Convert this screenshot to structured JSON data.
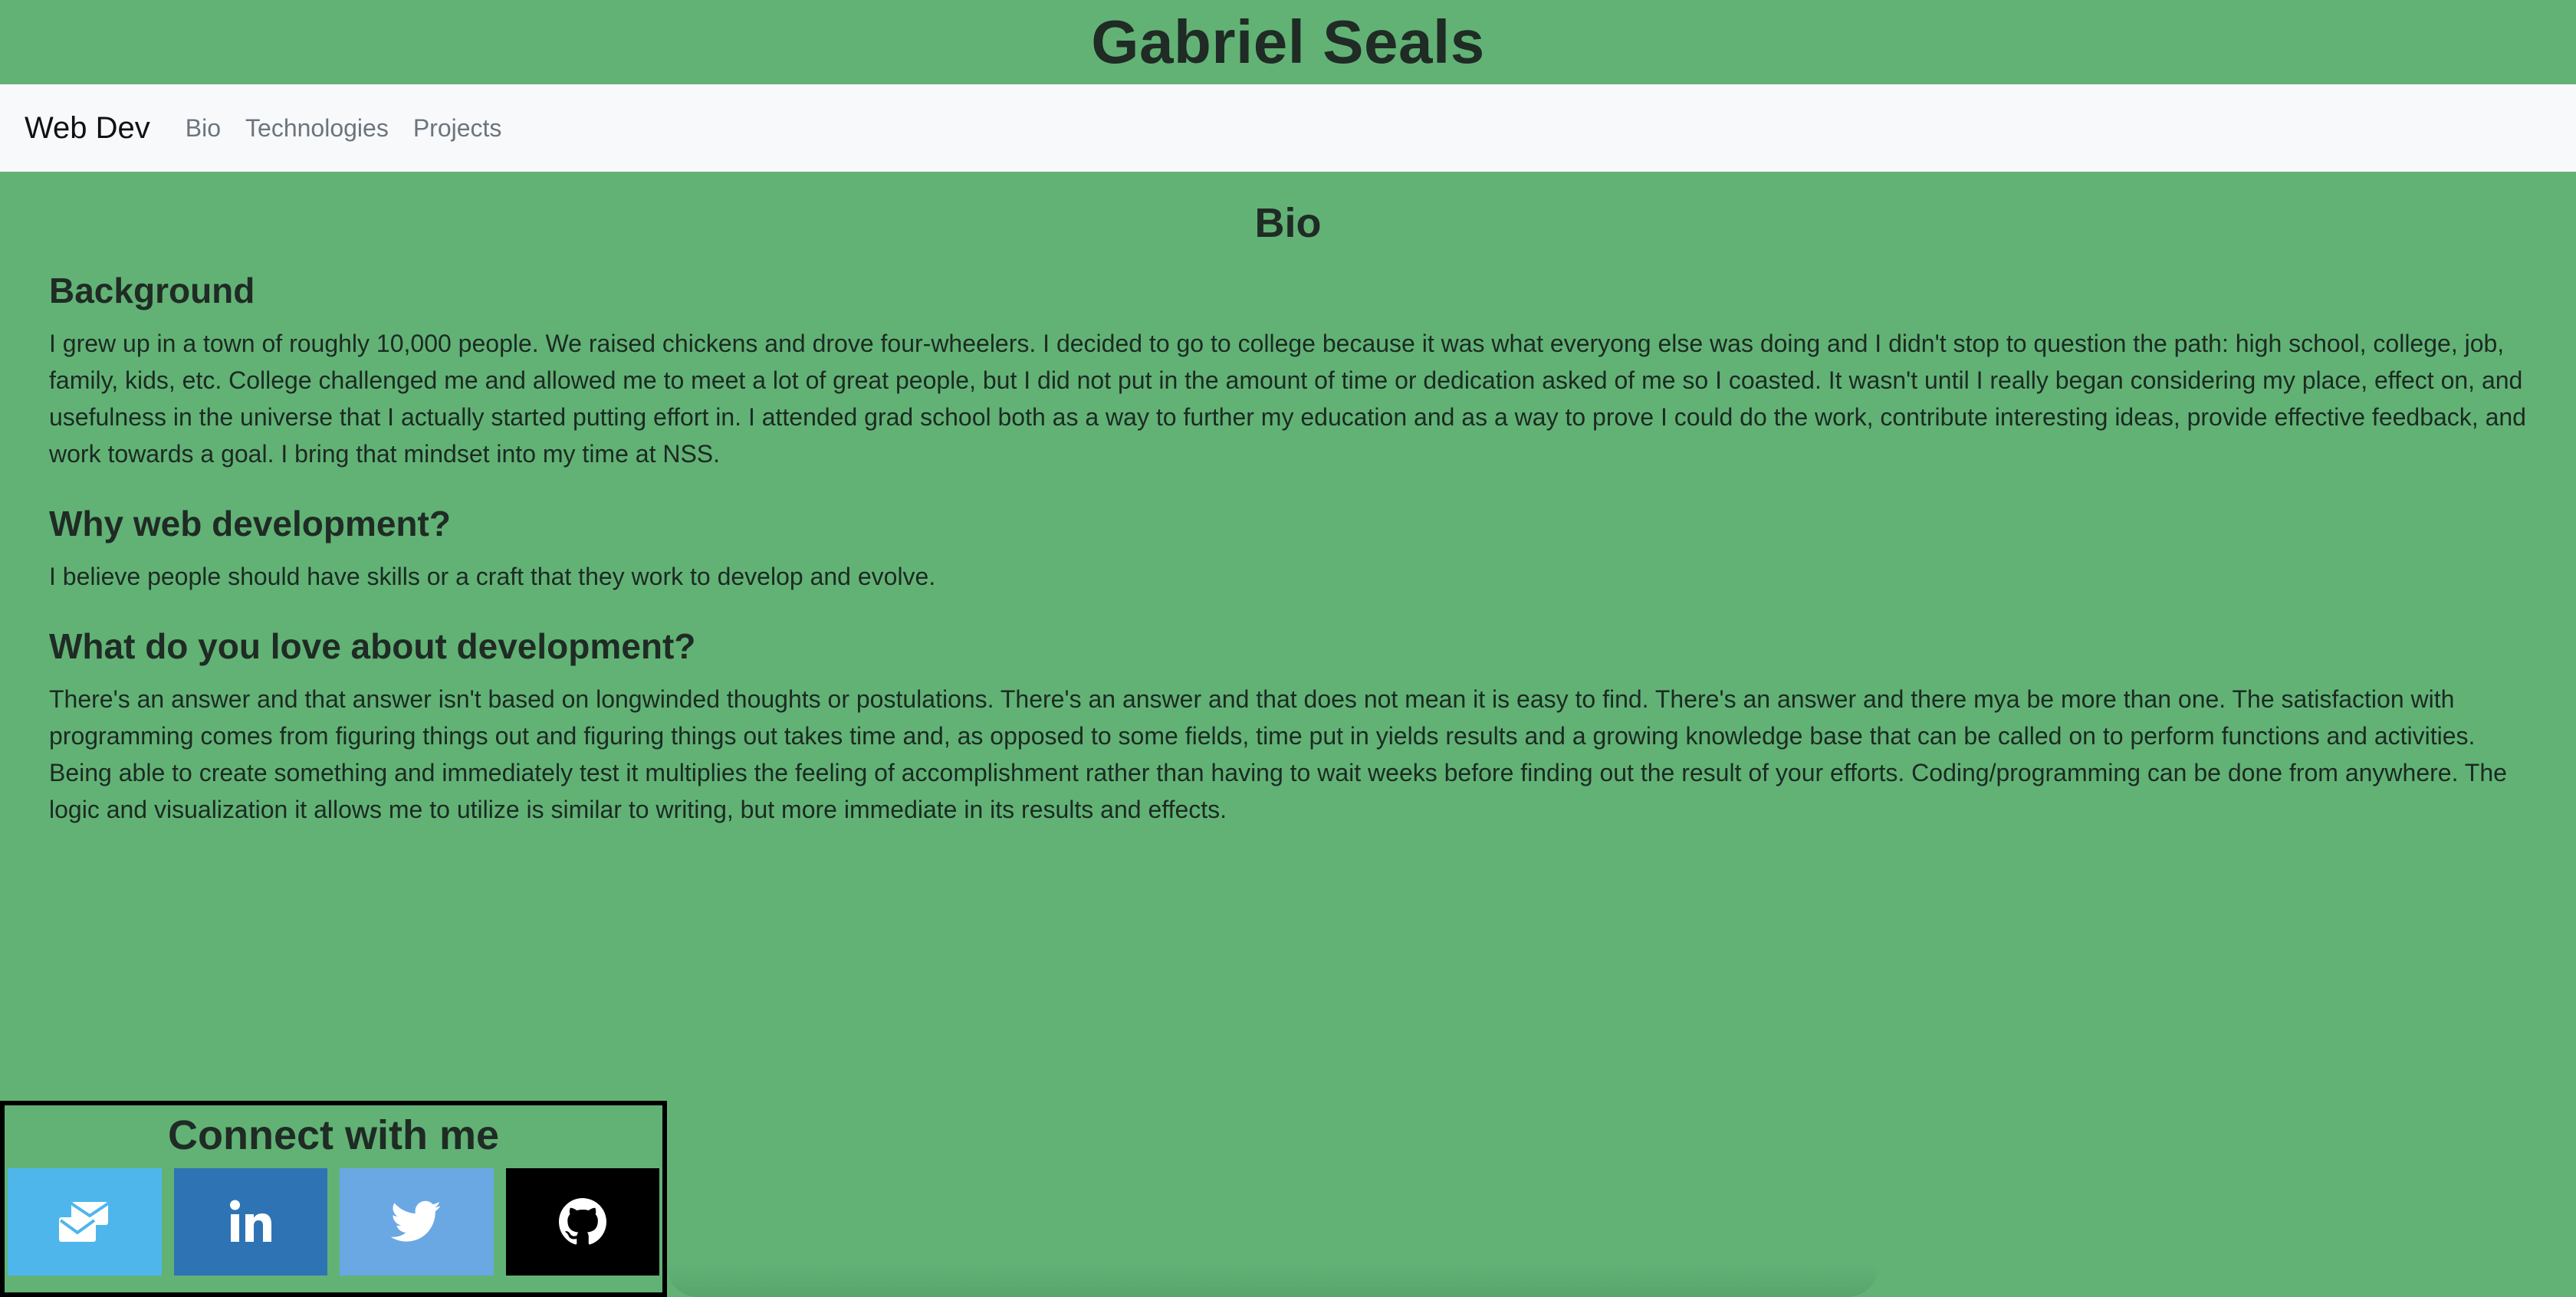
{
  "header": {
    "title": "Gabriel Seals"
  },
  "navbar": {
    "brand": "Web Dev",
    "links": [
      "Bio",
      "Technologies",
      "Projects"
    ]
  },
  "bio": {
    "title": "Bio",
    "sections": [
      {
        "heading": "Background",
        "text": "I grew up in a town of roughly 10,000 people. We raised chickens and drove four-wheelers. I decided to go to college because it was what everyong else was doing and I didn't stop to question the path: high school, college, job, family, kids, etc. College challenged me and allowed me to meet a lot of great people, but I did not put in the amount of time or dedication asked of me so I coasted. It wasn't until I really began considering my place, effect on, and usefulness in the universe that I actually started putting effort in. I attended grad school both as a way to further my education and as a way to prove I could do the work, contribute interesting ideas, provide effective feedback, and work towards a goal. I bring that mindset into my time at NSS."
      },
      {
        "heading": "Why web development?",
        "text": "I believe people should have skills or a craft that they work to develop and evolve."
      },
      {
        "heading": "What do you love about development?",
        "text": "There's an answer and that answer isn't based on longwinded thoughts or postulations. There's an answer and that does not mean it is easy to find. There's an answer and there mya be more than one. The satisfaction with programming comes from figuring things out and figuring things out takes time and, as opposed to some fields, time put in yields results and a growing knowledge base that can be called on to perform functions and activities. Being able to create something and immediately test it multiplies the feeling of accomplishment rather than having to wait weeks before finding out the result of your efforts. Coding/programming can be done from anywhere. The logic and visualization it allows me to utilize is similar to writing, but more immediate in its results and effects."
      }
    ]
  },
  "connect": {
    "title": "Connect with me",
    "buttons": [
      {
        "icon": "email-icon",
        "color": "#4fb6ec"
      },
      {
        "icon": "linkedin-icon",
        "color": "#2e74b5"
      },
      {
        "icon": "twitter-icon",
        "color": "#6aa8e4"
      },
      {
        "icon": "github-icon",
        "color": "#000000"
      }
    ]
  },
  "colors": {
    "page_background": "#62b276",
    "navbar_background": "#f8f9fa"
  }
}
